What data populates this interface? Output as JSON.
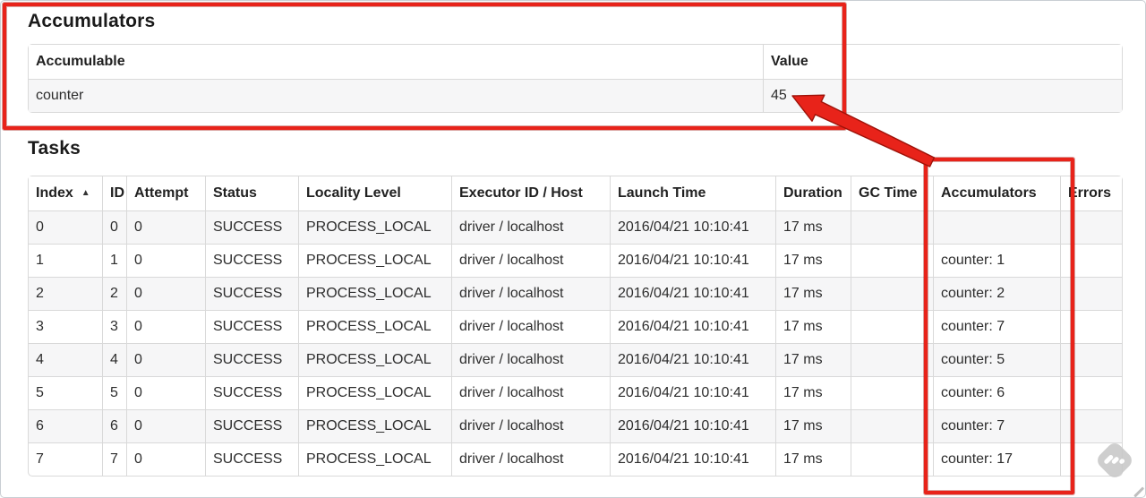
{
  "annotation": {
    "color": "#e8231a",
    "arrow_points_at": "45",
    "boxed_regions": [
      "accumulators-summary-section",
      "tasks-accumulators-column"
    ]
  },
  "accumulators_section": {
    "title": "Accumulators",
    "table": {
      "headers": [
        "Accumulable",
        "Value"
      ],
      "rows": [
        [
          "counter",
          "45"
        ]
      ]
    }
  },
  "tasks_section": {
    "title": "Tasks",
    "sort_indicator": "▲",
    "table": {
      "headers": [
        "Index",
        "ID",
        "Attempt",
        "Status",
        "Locality Level",
        "Executor ID / Host",
        "Launch Time",
        "Duration",
        "GC Time",
        "Accumulators",
        "Errors"
      ],
      "rows": [
        [
          "0",
          "0",
          "0",
          "SUCCESS",
          "PROCESS_LOCAL",
          "driver / localhost",
          "2016/04/21 10:10:41",
          "17 ms",
          "",
          "",
          ""
        ],
        [
          "1",
          "1",
          "0",
          "SUCCESS",
          "PROCESS_LOCAL",
          "driver / localhost",
          "2016/04/21 10:10:41",
          "17 ms",
          "",
          "counter: 1",
          ""
        ],
        [
          "2",
          "2",
          "0",
          "SUCCESS",
          "PROCESS_LOCAL",
          "driver / localhost",
          "2016/04/21 10:10:41",
          "17 ms",
          "",
          "counter: 2",
          ""
        ],
        [
          "3",
          "3",
          "0",
          "SUCCESS",
          "PROCESS_LOCAL",
          "driver / localhost",
          "2016/04/21 10:10:41",
          "17 ms",
          "",
          "counter: 7",
          ""
        ],
        [
          "4",
          "4",
          "0",
          "SUCCESS",
          "PROCESS_LOCAL",
          "driver / localhost",
          "2016/04/21 10:10:41",
          "17 ms",
          "",
          "counter: 5",
          ""
        ],
        [
          "5",
          "5",
          "0",
          "SUCCESS",
          "PROCESS_LOCAL",
          "driver / localhost",
          "2016/04/21 10:10:41",
          "17 ms",
          "",
          "counter: 6",
          ""
        ],
        [
          "6",
          "6",
          "0",
          "SUCCESS",
          "PROCESS_LOCAL",
          "driver / localhost",
          "2016/04/21 10:10:41",
          "17 ms",
          "",
          "counter: 7",
          ""
        ],
        [
          "7",
          "7",
          "0",
          "SUCCESS",
          "PROCESS_LOCAL",
          "driver / localhost",
          "2016/04/21 10:10:41",
          "17 ms",
          "",
          "counter: 17",
          ""
        ]
      ]
    }
  }
}
